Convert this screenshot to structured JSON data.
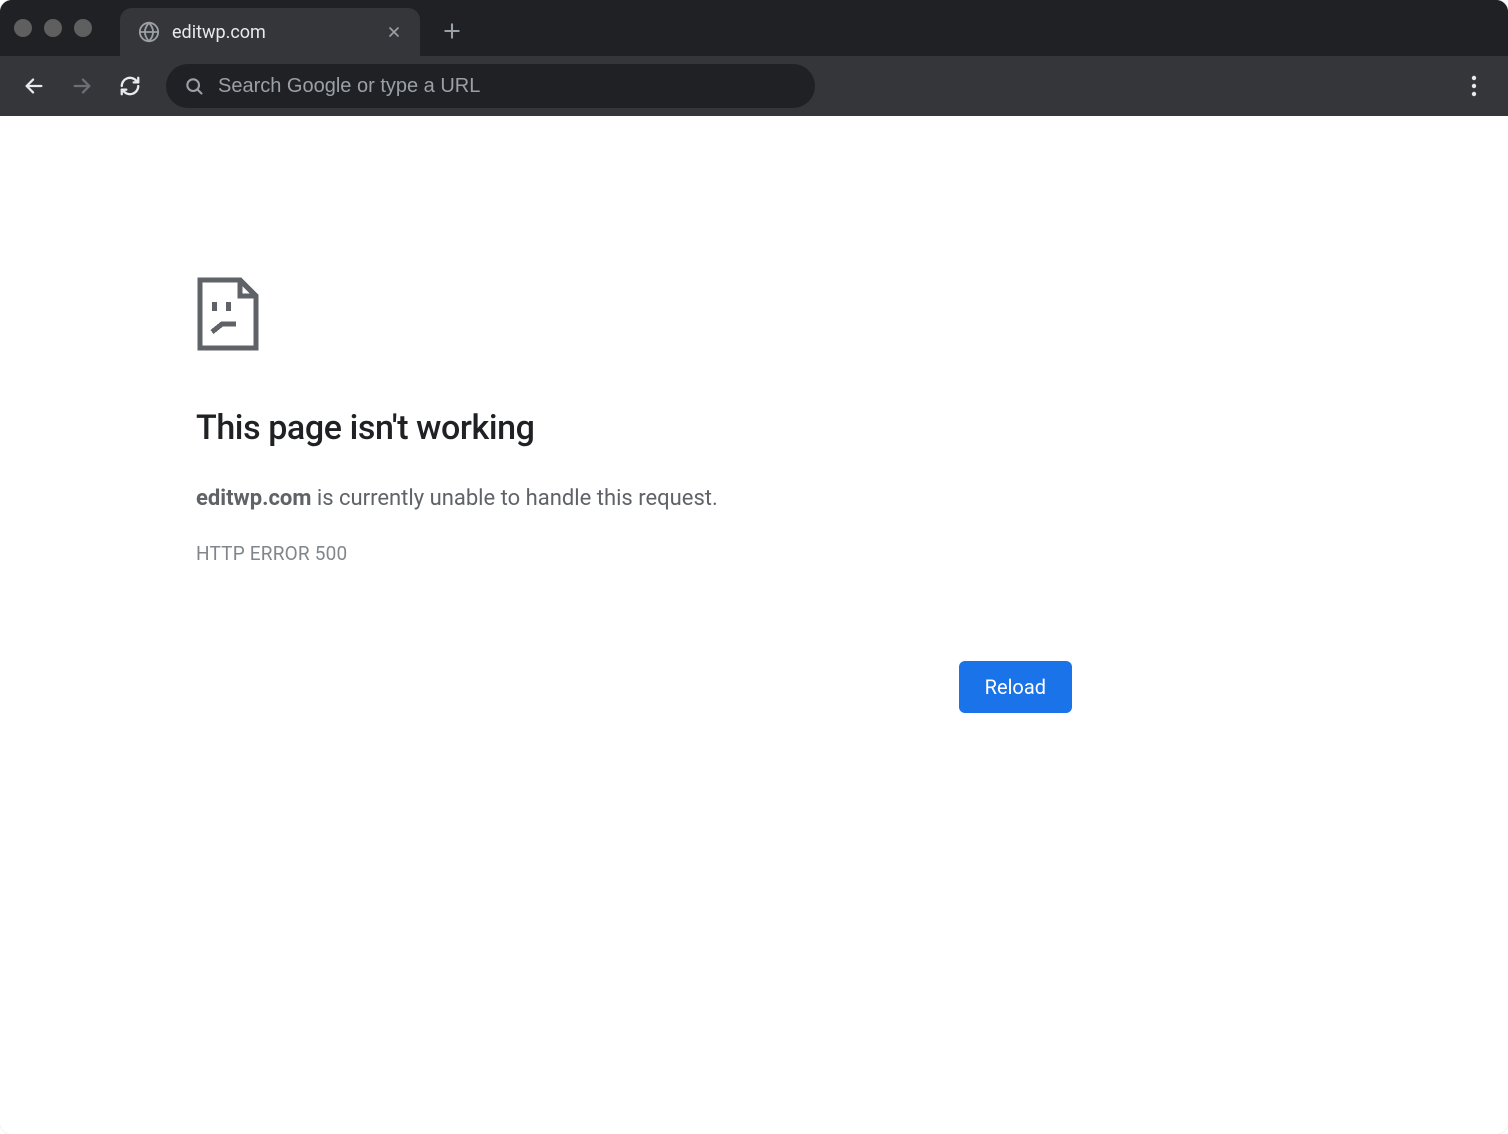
{
  "tab": {
    "title": "editwp.com"
  },
  "toolbar": {
    "omnibox_placeholder": "Search Google or type a URL"
  },
  "error": {
    "title": "This page isn't working",
    "host": "editwp.com",
    "message_suffix": " is currently unable to handle this request.",
    "code": "HTTP ERROR 500",
    "reload_label": "Reload"
  }
}
